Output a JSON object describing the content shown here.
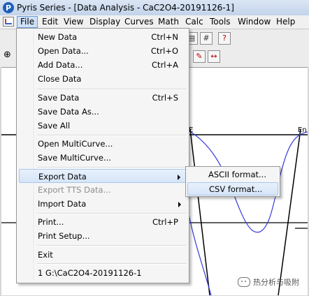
{
  "window": {
    "title": "Pyris Series - [Data Analysis - CaC2O4-20191126-1]",
    "icon_letter": "P"
  },
  "menubar": {
    "items": [
      {
        "label": "File"
      },
      {
        "label": "Edit"
      },
      {
        "label": "View"
      },
      {
        "label": "Display"
      },
      {
        "label": "Curves"
      },
      {
        "label": "Math"
      },
      {
        "label": "Calc"
      },
      {
        "label": "Tools"
      },
      {
        "label": "Window"
      },
      {
        "label": "Help"
      }
    ],
    "active": "File"
  },
  "file_menu": {
    "new_data": {
      "label": "New Data",
      "shortcut": "Ctrl+N"
    },
    "open_data": {
      "label": "Open Data...",
      "shortcut": "Ctrl+O"
    },
    "add_data": {
      "label": "Add Data...",
      "shortcut": "Ctrl+A"
    },
    "close_data": {
      "label": "Close Data"
    },
    "save_data": {
      "label": "Save Data",
      "shortcut": "Ctrl+S"
    },
    "save_data_as": {
      "label": "Save Data As..."
    },
    "save_all": {
      "label": "Save All"
    },
    "open_multicurve": {
      "label": "Open MultiCurve..."
    },
    "save_multicurve": {
      "label": "Save MultiCurve..."
    },
    "export_data": {
      "label": "Export Data"
    },
    "export_tts": {
      "label": "Export TTS Data..."
    },
    "import_data": {
      "label": "Import Data"
    },
    "print": {
      "label": "Print...",
      "shortcut": "Ctrl+P"
    },
    "print_setup": {
      "label": "Print Setup..."
    },
    "exit": {
      "label": "Exit"
    },
    "recent_1": {
      "label": "1 G:\\CaC2O4-20191126-1"
    }
  },
  "export_submenu": {
    "ascii": {
      "label": "ASCII format..."
    },
    "csv": {
      "label": "CSV format..."
    }
  },
  "plot": {
    "label_left": "E",
    "label_right": "En"
  },
  "watermark": {
    "text": "热分析与吸附"
  },
  "colors": {
    "curve": "#3a3adc",
    "highlight": "#cfe0f7"
  },
  "icons": [
    "app-icon",
    "document-icon",
    "zoom-icon",
    "submenu-arrow-icon",
    "wechat-icon"
  ]
}
